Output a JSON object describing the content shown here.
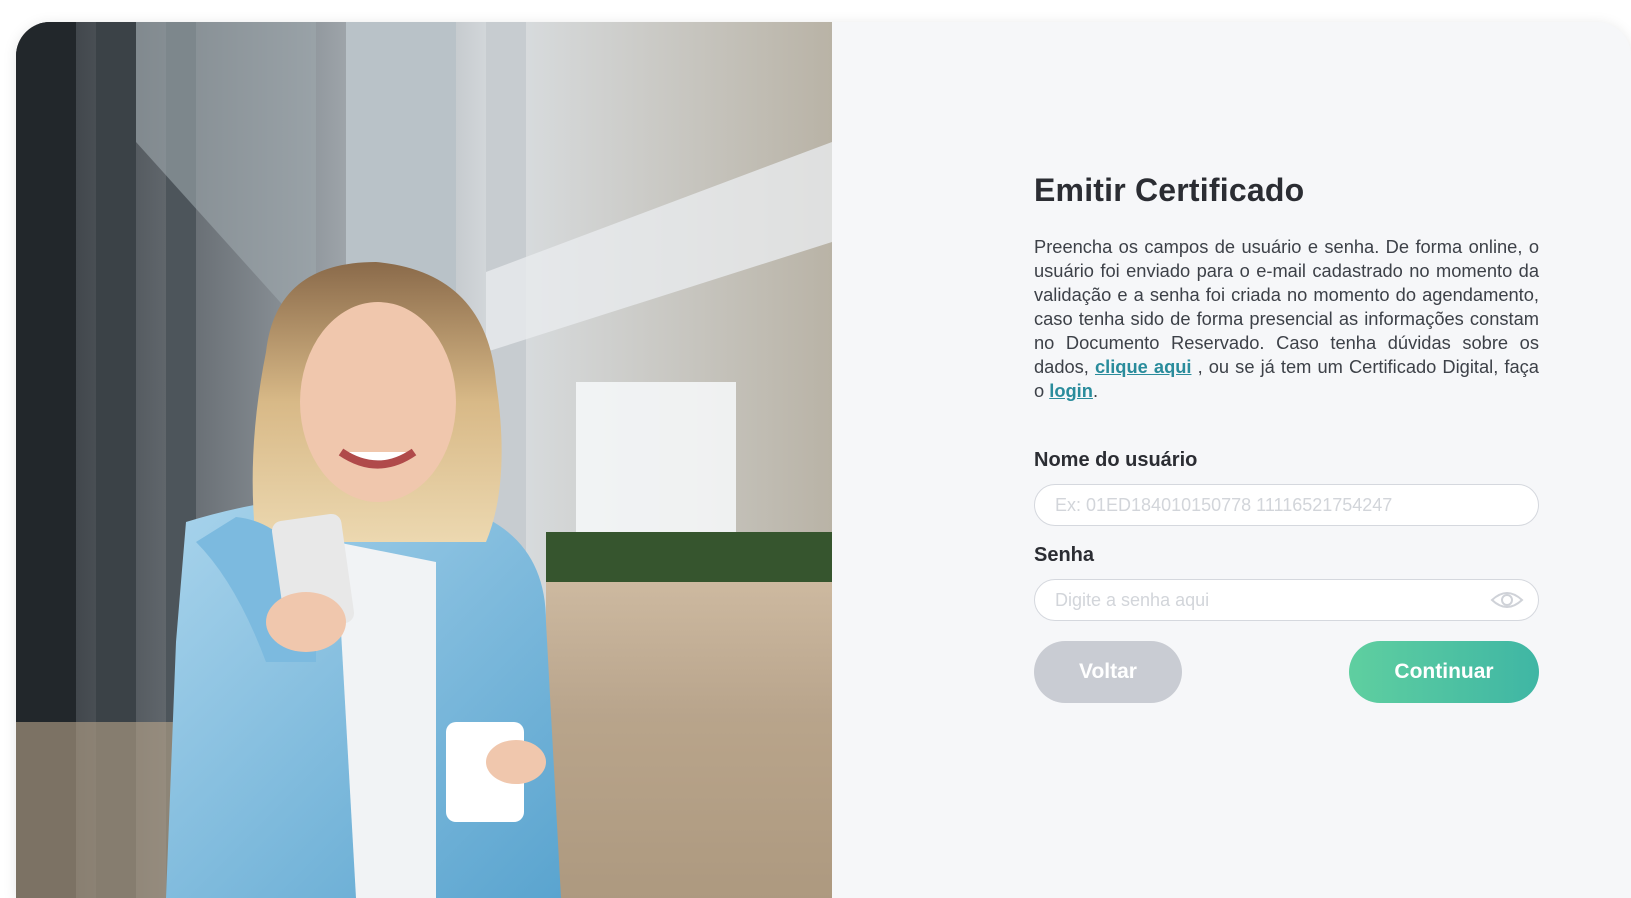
{
  "form": {
    "title": "Emitir Certificado",
    "description_part1": "Preencha os campos de usuário e senha. De forma online, o usuário foi enviado para o e-mail cadastrado no momento da validação e a senha foi criada no momento do agendamento, caso tenha sido de forma presencial as informações constam no Documento Reservado. Caso tenha dúvidas sobre os dados,",
    "link_help": "clique aqui",
    "description_part2": ", ou se já tem um Certificado Digital, faça o",
    "link_login": "login",
    "description_end": ".",
    "username_label": "Nome do usuário",
    "username_placeholder": "Ex: 01ED184010150778 11116521754247",
    "username_value": "",
    "password_label": "Senha",
    "password_placeholder": "Digite a senha aqui",
    "password_value": "",
    "back_button": "Voltar",
    "continue_button": "Continuar"
  },
  "icons": {
    "password_toggle": "eye-icon"
  },
  "colors": {
    "link": "#2a8c9c",
    "continue_gradient_start": "#5fcfa0",
    "continue_gradient_end": "#3fb6a4",
    "back_button": "#c9ccd3"
  }
}
